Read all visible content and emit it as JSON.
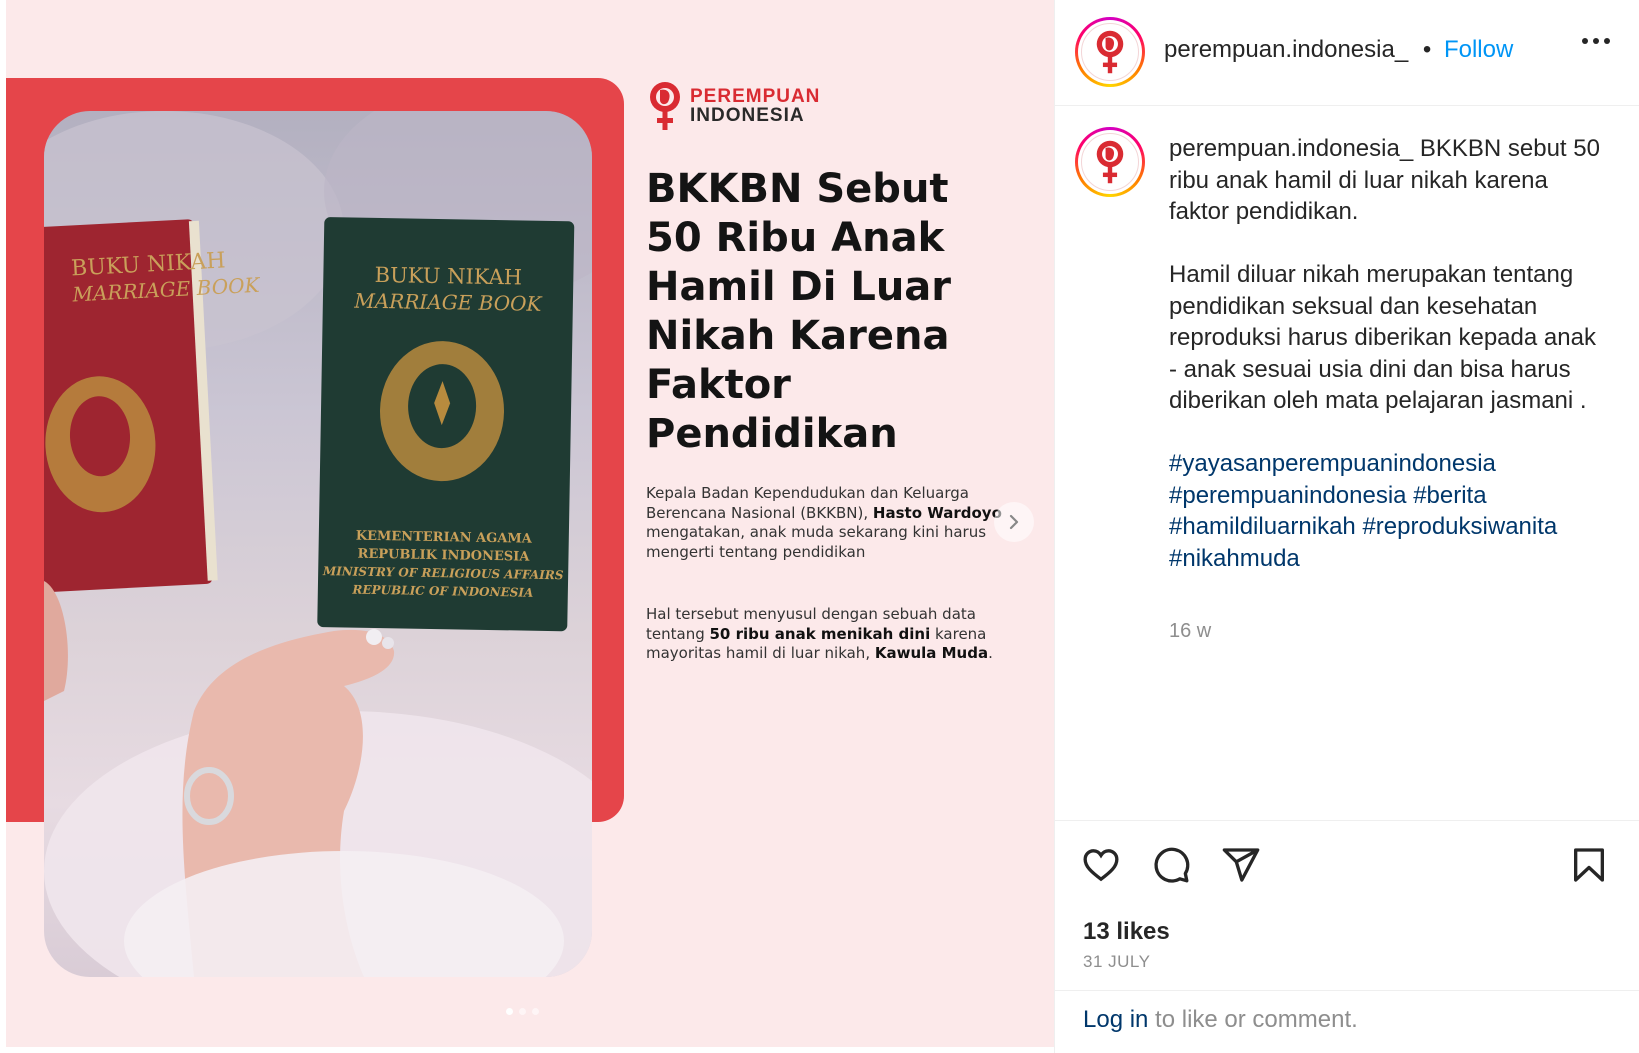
{
  "media": {
    "brand": {
      "line1": "PEREMPUAN",
      "line2": "INDONESIA"
    },
    "headline": "BKKBN Sebut 50 Ribu Anak Hamil Di Luar Nikah Karena Faktor Pendidikan",
    "para1": {
      "t1": "Kepala Badan Kependudukan dan Keluarga Berencana Nasional (BKKBN), ",
      "b1": "Hasto Wardoyo",
      "t2": " mengatakan, anak muda sekarang kini harus mengerti tentang pendidikan"
    },
    "para2": {
      "t1": "Hal tersebut menyusul dengan sebuah data tentang ",
      "b1": "50 ribu anak menikah dini",
      "t2": " karena mayoritas hamil di luar nikah, ",
      "b2": "Kawula Muda",
      "t3": "."
    },
    "book_red": {
      "title1": "BUKU NIKAH",
      "title2": "MARRIAGE BOOK"
    },
    "book_green": {
      "title1": "BUKU NIKAH",
      "title2": "MARRIAGE BOOK",
      "sub1": "KEMENTERIAN AGAMA",
      "sub2": "REPUBLIK INDONESIA",
      "sub3": "MINISTRY OF RELIGIOUS AFFAIRS",
      "sub4": "REPUBLIC OF INDONESIA"
    },
    "slides": {
      "total": 3,
      "active": 1
    },
    "icons": {
      "next": "chevron-right-icon"
    }
  },
  "post": {
    "username": "perempuan.indonesia_",
    "separator": "•",
    "follow_label": "Follow",
    "caption": {
      "username": "perempuan.indonesia_",
      "intro": " BKKBN sebut 50 ribu anak hamil di luar nikah karena faktor pendidikan.",
      "body": "Hamil diluar nikah merupakan tentang pendidikan seksual dan kesehatan reproduksi harus diberikan kepada anak - anak sesuai usia dini dan bisa harus diberikan oleh mata pelajaran jasmani .",
      "hashtags": [
        "#yayasanperempuanindonesia",
        "#perempuanindonesia",
        "#berita",
        "#hamildiluarnikah",
        "#reproduksiwanita",
        "#nikahmuda"
      ]
    },
    "time_ago": "16 w",
    "likes": "13 likes",
    "date": "31 JULY",
    "footer": {
      "login": "Log in",
      "rest": " to like or comment."
    },
    "colors": {
      "link": "#0095f6",
      "hashtag": "#00376b",
      "brand_red": "#d92b32"
    },
    "icons": [
      "heart-icon",
      "comment-icon",
      "share-icon",
      "bookmark-icon",
      "more-icon"
    ]
  }
}
